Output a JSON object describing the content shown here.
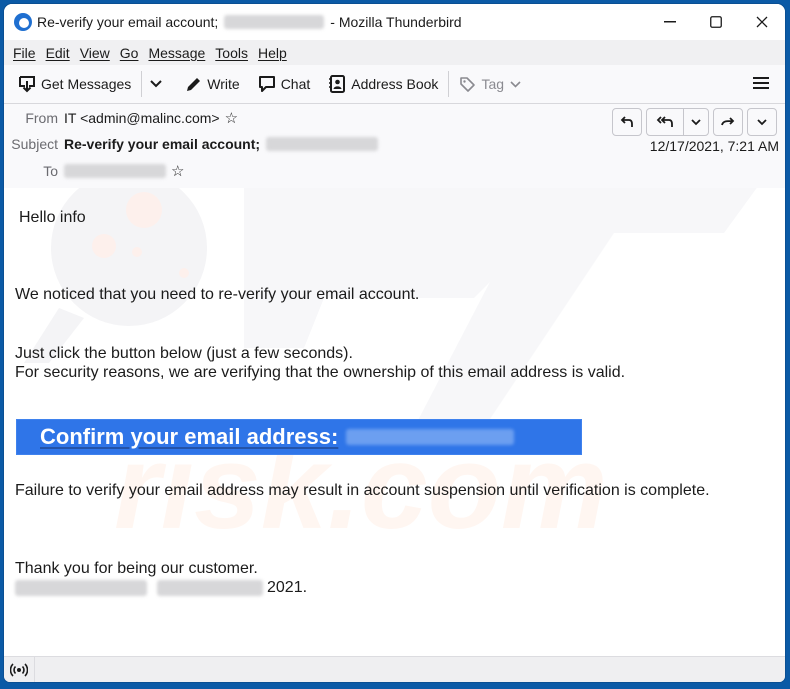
{
  "window": {
    "title_prefix": "Re-verify your email account;",
    "title_suffix": "- Mozilla Thunderbird",
    "controls": {
      "minimize": "—",
      "maximize": "☐",
      "close": "✕"
    }
  },
  "menubar": {
    "items": [
      {
        "label": "File"
      },
      {
        "label": "Edit"
      },
      {
        "label": "View"
      },
      {
        "label": "Go"
      },
      {
        "label": "Message"
      },
      {
        "label": "Tools"
      },
      {
        "label": "Help"
      }
    ]
  },
  "toolbar": {
    "get_messages": "Get Messages",
    "write": "Write",
    "chat": "Chat",
    "address_book": "Address Book",
    "tag": "Tag"
  },
  "header": {
    "from_label": "From",
    "from_value": "IT <admin@malinc.com>",
    "subject_label": "Subject",
    "subject_value": "Re-verify your email account;",
    "to_label": "To",
    "date": "12/17/2021, 7:21 AM",
    "buttons": [
      "reply",
      "reply-all",
      "more-reply",
      "forward",
      "more"
    ]
  },
  "message": {
    "greeting": "Hello info",
    "line1": "We noticed that you need to re-verify your email account.",
    "line2": "Just click the button below (just a few seconds).",
    "line3": "For security reasons, we are verifying that the ownership of this email address is valid.",
    "button_label": "Confirm your email address:",
    "warning": "Failure to verify your email address may result in account suspension until verification is complete.",
    "thanks": "Thank you for being our customer.",
    "signature_suffix": "2021."
  },
  "colors": {
    "window_border": "#0b5aa6",
    "confirm_button": "#2f75e8",
    "text": "#1b1b1b"
  }
}
